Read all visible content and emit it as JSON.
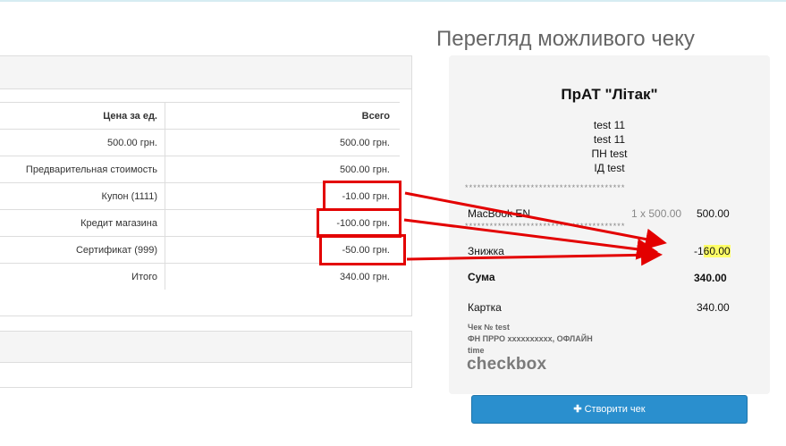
{
  "table": {
    "headers": [
      "Цена за ед.",
      "Всего"
    ],
    "rows": [
      [
        "500.00 грн.",
        "500.00 грн."
      ],
      [
        "Предварительная стоимость",
        "500.00 грн."
      ],
      [
        "Купон (1111)",
        "-10.00 грн."
      ],
      [
        "Кредит магазина",
        "-100.00 грн."
      ],
      [
        "Сертификат (999)",
        "-50.00 грн."
      ],
      [
        "Итого",
        "340.00 грн."
      ]
    ]
  },
  "preview": {
    "title": "Перегляд можливого чеку",
    "company": "ПрАТ \"Літак\"",
    "info": [
      "test 11",
      "test 11",
      "ПН test",
      "ІД test"
    ],
    "stars": "***************************************",
    "item": {
      "name": "MacBook EN",
      "qty": "1 x 500.00",
      "price": "500.00"
    },
    "discount": {
      "label": "Знижка",
      "value_prefix": "-1",
      "value_highlight": "60.00"
    },
    "sum": {
      "label": "Сума",
      "value": "340.00"
    },
    "payment": {
      "label": "Картка",
      "value": "340.00"
    },
    "footer": [
      "Чек № test",
      "ФН ПРРО xxxxxxxxxx, ОФЛАЙН",
      "time"
    ],
    "logo": "checkbox"
  },
  "create_button": {
    "icon": "plus-icon",
    "label": "Створити чек"
  },
  "colors": {
    "button": "#2a8fce",
    "annotation": "#e30000",
    "highlight": "#ffff66"
  }
}
